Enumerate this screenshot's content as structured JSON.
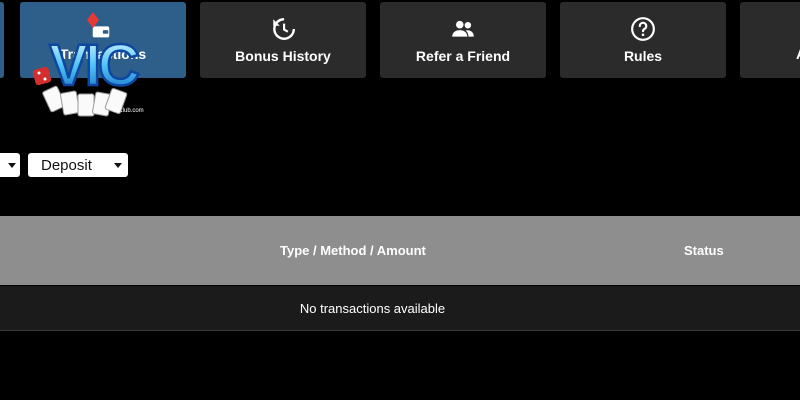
{
  "tabs": [
    {
      "label": "Transactions",
      "icon": "wallet-icon",
      "active": true
    },
    {
      "label": "Bonus History",
      "icon": "history-icon"
    },
    {
      "label": "Refer a Friend",
      "icon": "users-icon"
    },
    {
      "label": "Rules",
      "icon": "question-circle-icon"
    }
  ],
  "logo": {
    "text": "VIC",
    "subtext": "vicclub.com"
  },
  "filters": {
    "first_select": "",
    "type_select": "Deposit"
  },
  "table": {
    "columns": [
      "Type / Method / Amount",
      "Status"
    ],
    "empty_message": "No transactions available"
  },
  "colors": {
    "active_tab": "#2e5f8a",
    "tab": "#2b2b2b",
    "table_header": "#8e8e8e"
  }
}
